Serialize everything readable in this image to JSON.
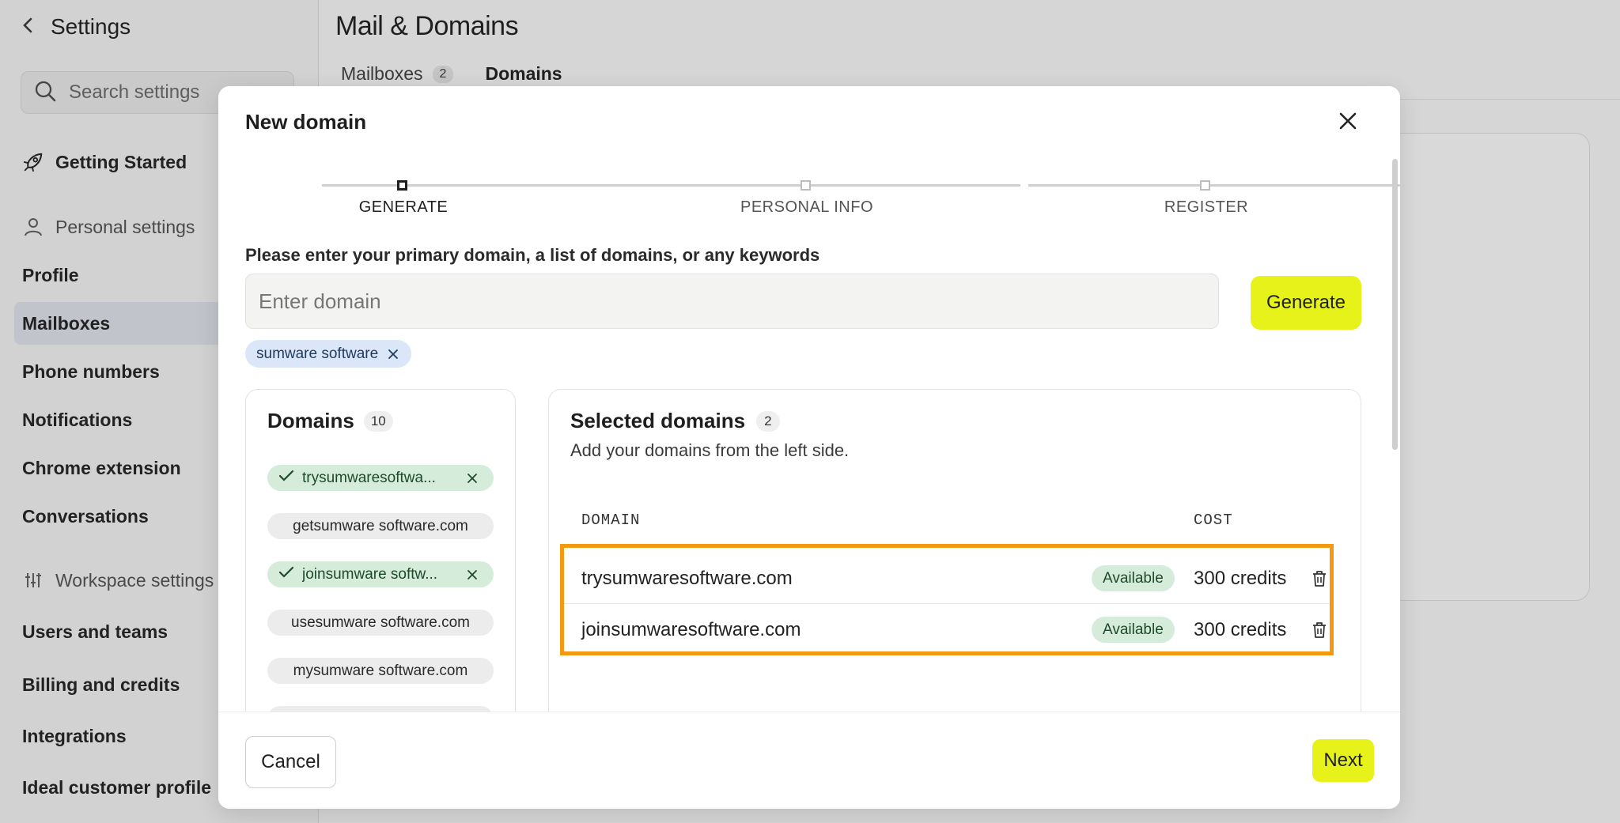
{
  "sidebar": {
    "title": "Settings",
    "search_placeholder": "Search settings",
    "getting_started": "Getting Started",
    "personal_group": "Personal settings",
    "personal_items": [
      "Profile",
      "Mailboxes",
      "Phone numbers",
      "Notifications",
      "Chrome extension",
      "Conversations"
    ],
    "workspace_group": "Workspace settings",
    "workspace_items": [
      "Users and teams",
      "Billing and credits",
      "Integrations",
      "Ideal customer profile"
    ]
  },
  "main": {
    "title": "Mail & Domains",
    "tabs": [
      {
        "label": "Mailboxes",
        "count": "2"
      },
      {
        "label": "Domains"
      }
    ]
  },
  "modal": {
    "title": "New domain",
    "steps": [
      "GENERATE",
      "PERSONAL INFO",
      "REGISTER"
    ],
    "prompt": "Please enter your primary domain, a list of domains, or any keywords",
    "input_placeholder": "Enter domain",
    "generate_label": "Generate",
    "keyword_chip": "sumware software",
    "domains_panel": {
      "title": "Domains",
      "count": "10",
      "items": [
        {
          "label": "trysumwaresoftwa...",
          "selected": true
        },
        {
          "label": "getsumware software.com",
          "selected": false
        },
        {
          "label": "joinsumware softw...",
          "selected": true
        },
        {
          "label": "usesumware software.com",
          "selected": false
        },
        {
          "label": "mysumware software.com",
          "selected": false
        }
      ]
    },
    "selected_panel": {
      "title": "Selected domains",
      "count": "2",
      "subtitle": "Add your domains from the left side.",
      "col_domain": "DOMAIN",
      "col_cost": "COST",
      "rows": [
        {
          "domain": "trysumwaresoftware.com",
          "status": "Available",
          "cost": "300 credits"
        },
        {
          "domain": "joinsumwaresoftware.com",
          "status": "Available",
          "cost": "300 credits"
        }
      ]
    },
    "cancel_label": "Cancel",
    "next_label": "Next"
  },
  "colors": {
    "accent": "#e7f21b",
    "highlight_border": "#f39a12",
    "available_bg": "#d6ecdb",
    "keyword_chip_bg": "#dbe6f8"
  }
}
